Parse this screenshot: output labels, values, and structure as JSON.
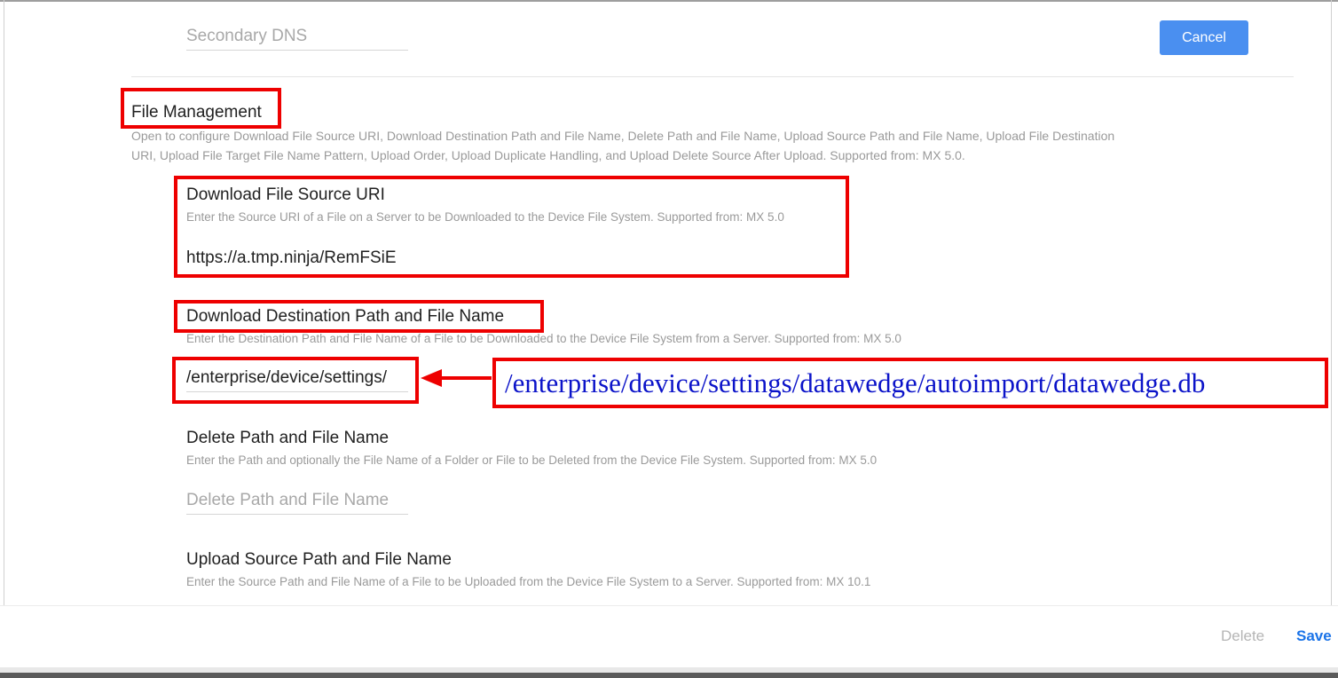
{
  "header_section": {
    "secondary_dns_placeholder": "Secondary DNS",
    "cancel_label": "Cancel"
  },
  "file_management": {
    "title": "File Management",
    "description_line1": "Open to configure Download File Source URI, Download Destination Path and File Name, Delete Path and File Name, Upload Source Path and File Name, Upload File Destination",
    "description_line2": "URI, Upload File Target File Name Pattern, Upload Order, Upload Duplicate Handling, and Upload Delete Source After Upload. Supported from: MX 5.0."
  },
  "fields": {
    "download_source": {
      "label": "Download File Source URI",
      "description": "Enter the Source URI of a File on a Server to be Downloaded to the Device File System. Supported from: MX 5.0",
      "value": "https://a.tmp.ninja/RemFSiE"
    },
    "download_destination": {
      "label": "Download Destination Path and File Name",
      "description": "Enter the Destination Path and File Name of a File to be Downloaded to the Device File System from a Server. Supported from: MX 5.0",
      "value": "/enterprise/device/settings/"
    },
    "delete_path": {
      "label": "Delete Path and File Name",
      "description": "Enter the Path and optionally the File Name of a Folder or File to be Deleted from the Device File System. Supported from: MX 5.0",
      "placeholder": "Delete Path and File Name"
    },
    "upload_source": {
      "label": "Upload Source Path and File Name",
      "description": "Enter the Source Path and File Name of a File to be Uploaded from the Device File System to a Server. Supported from: MX 10.1"
    }
  },
  "annotation": {
    "full_path": "/enterprise/device/settings/datawedge/autoimport/datawedge.db",
    "highlight_color": "#ee0000",
    "text_color": "#0b13c9"
  },
  "footer": {
    "delete_label": "Delete",
    "save_label": "Save"
  },
  "colors": {
    "accent": "#4a8ff0",
    "save": "#1a73e8"
  }
}
